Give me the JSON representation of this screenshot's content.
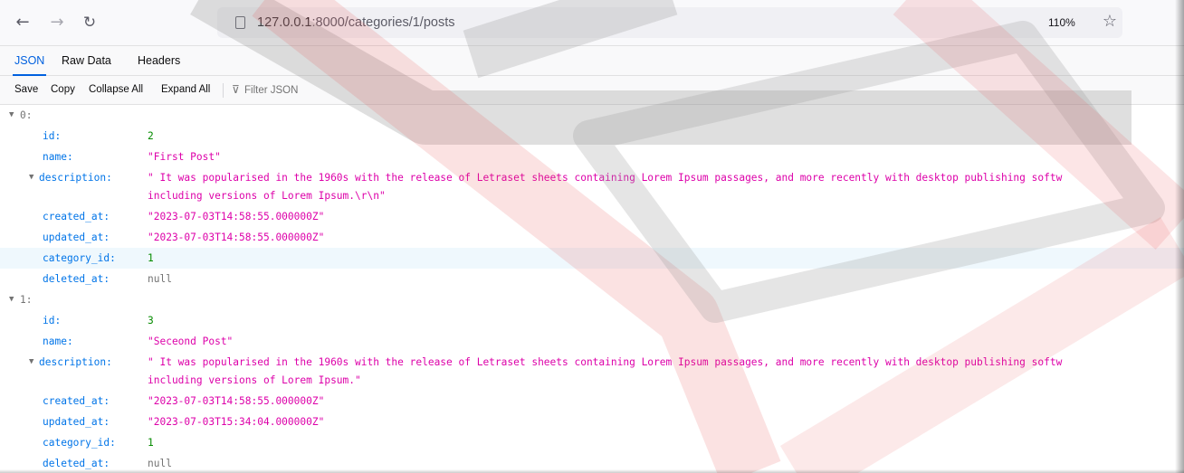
{
  "browser": {
    "url_host": "127.0.0.1",
    "url_path": ":8000/categories/1/posts",
    "zoom": "110%",
    "icons": {
      "back": "arrow-left-icon",
      "forward": "arrow-right-icon",
      "reload": "reload-icon",
      "page": "page-icon",
      "bookmark": "star-icon"
    }
  },
  "viewer": {
    "tabs": [
      "JSON",
      "Raw Data",
      "Headers"
    ],
    "tools": {
      "save": "Save",
      "copy": "Copy",
      "collapse_all": "Collapse All",
      "expand_all": "Expand All",
      "filter_placeholder": "Filter JSON"
    }
  },
  "tree": [
    {
      "index": "0:",
      "fields": {
        "id": {
          "key": "id:",
          "value": "2"
        },
        "name": {
          "key": "name:",
          "value": "\"First Post\""
        },
        "description": {
          "key": "description:",
          "line1": "\" It was popularised in the 1960s with the release of Letraset sheets containing Lorem Ipsum passages, and more recently with desktop publishing softw",
          "line2": "including versions of Lorem Ipsum.\\r\\n\""
        },
        "created_at": {
          "key": "created_at:",
          "value": "\"2023-07-03T14:58:55.000000Z\""
        },
        "updated_at": {
          "key": "updated_at:",
          "value": "\"2023-07-03T14:58:55.000000Z\""
        },
        "category_id": {
          "key": "category_id:",
          "value": "1"
        },
        "deleted_at": {
          "key": "deleted_at:",
          "value": "null"
        }
      }
    },
    {
      "index": "1:",
      "fields": {
        "id": {
          "key": "id:",
          "value": "3"
        },
        "name": {
          "key": "name:",
          "value": "\"Seceond Post\""
        },
        "description": {
          "key": "description:",
          "line1": "\" It was popularised in the 1960s with the release of Letraset sheets containing Lorem Ipsum passages, and more recently with desktop publishing softw",
          "line2": "including versions of Lorem Ipsum.\""
        },
        "created_at": {
          "key": "created_at:",
          "value": "\"2023-07-03T14:58:55.000000Z\""
        },
        "updated_at": {
          "key": "updated_at:",
          "value": "\"2023-07-03T15:34:04.000000Z\""
        },
        "category_id": {
          "key": "category_id:",
          "value": "1"
        },
        "deleted_at": {
          "key": "deleted_at:",
          "value": "null"
        }
      }
    }
  ],
  "colors": {
    "key": "#0074e8",
    "string": "#dd00a9",
    "number": "#058b00",
    "null": "#737373",
    "accent": "#0060df",
    "watermark_red": "#e8494b"
  }
}
